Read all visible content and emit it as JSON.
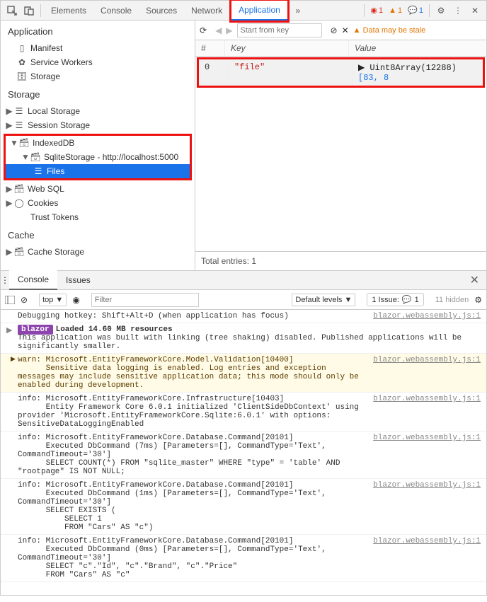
{
  "toolbar": {
    "tabs": [
      "Elements",
      "Console",
      "Sources",
      "Network",
      "Application"
    ],
    "activeTab": "Application",
    "errors": "1",
    "warnings": "1",
    "infos": "1"
  },
  "leftPanel": {
    "appSection": "Application",
    "appItems": [
      "Manifest",
      "Service Workers",
      "Storage"
    ],
    "storageSection": "Storage",
    "storageTree": {
      "localStorage": "Local Storage",
      "sessionStorage": "Session Storage",
      "indexedDB": "IndexedDB",
      "sqliteStorage": "SqliteStorage - http://localhost:5000",
      "files": "Files",
      "webSQL": "Web SQL",
      "cookies": "Cookies",
      "trustTokens": "Trust Tokens"
    },
    "cacheSection": "Cache",
    "cacheStorage": "Cache Storage"
  },
  "rightPanel": {
    "startFromKeyPlaceholder": "Start from key",
    "staleText": "Data may be stale",
    "headers": {
      "num": "#",
      "key": "Key",
      "value": "Value"
    },
    "row": {
      "num": "0",
      "key": "\"file\"",
      "valPrefix": "▶ Uint8Array(12288) ",
      "valArr": "[83, 8"
    },
    "footer": "Total entries: 1"
  },
  "drawer": {
    "tabs": [
      "Console",
      "Issues"
    ],
    "active": "Console"
  },
  "consoleToolbar": {
    "context": "top ▼",
    "filterPlaceholder": "Filter",
    "levels": "Default levels ▼",
    "issues": "1 Issue:",
    "issuesCount": "1",
    "hidden": "11 hidden"
  },
  "consoleLogs": [
    {
      "type": "plain",
      "text": "Debugging hotkey: Shift+Alt+D (when application has focus)",
      "src": "blazor.webassembly.js:1"
    },
    {
      "type": "blazor",
      "badge": "blazor",
      "bold": "Loaded 14.60 MB resources",
      "text": "This application was built with linking (tree shaking) disabled. Published applications will be significantly smaller.",
      "src": ""
    },
    {
      "type": "warn",
      "text": "warn: Microsoft.EntityFrameworkCore.Model.Validation[10400]\n      Sensitive data logging is enabled. Log entries and exception messages may include sensitive application data; this mode should only be enabled during development.",
      "src": "blazor.webassembly.js:1"
    },
    {
      "type": "info",
      "text": "info: Microsoft.EntityFrameworkCore.Infrastructure[10403]\n      Entity Framework Core 6.0.1 initialized 'ClientSideDbContext' using provider 'Microsoft.EntityFrameworkCore.Sqlite:6.0.1' with options: SensitiveDataLoggingEnabled",
      "src": "blazor.webassembly.js:1"
    },
    {
      "type": "info",
      "text": "info: Microsoft.EntityFrameworkCore.Database.Command[20101]\n      Executed DbCommand (7ms) [Parameters=[], CommandType='Text', CommandTimeout='30']\n      SELECT COUNT(*) FROM \"sqlite_master\" WHERE \"type\" = 'table' AND \"rootpage\" IS NOT NULL;",
      "src": "blazor.webassembly.js:1"
    },
    {
      "type": "info",
      "text": "info: Microsoft.EntityFrameworkCore.Database.Command[20101]\n      Executed DbCommand (1ms) [Parameters=[], CommandType='Text', CommandTimeout='30']\n      SELECT EXISTS (\n          SELECT 1\n          FROM \"Cars\" AS \"c\")",
      "src": "blazor.webassembly.js:1"
    },
    {
      "type": "info",
      "text": "info: Microsoft.EntityFrameworkCore.Database.Command[20101]\n      Executed DbCommand (0ms) [Parameters=[], CommandType='Text', CommandTimeout='30']\n      SELECT \"c\".\"Id\", \"c\".\"Brand\", \"c\".\"Price\"\n      FROM \"Cars\" AS \"c\"",
      "src": "blazor.webassembly.js:1"
    }
  ]
}
